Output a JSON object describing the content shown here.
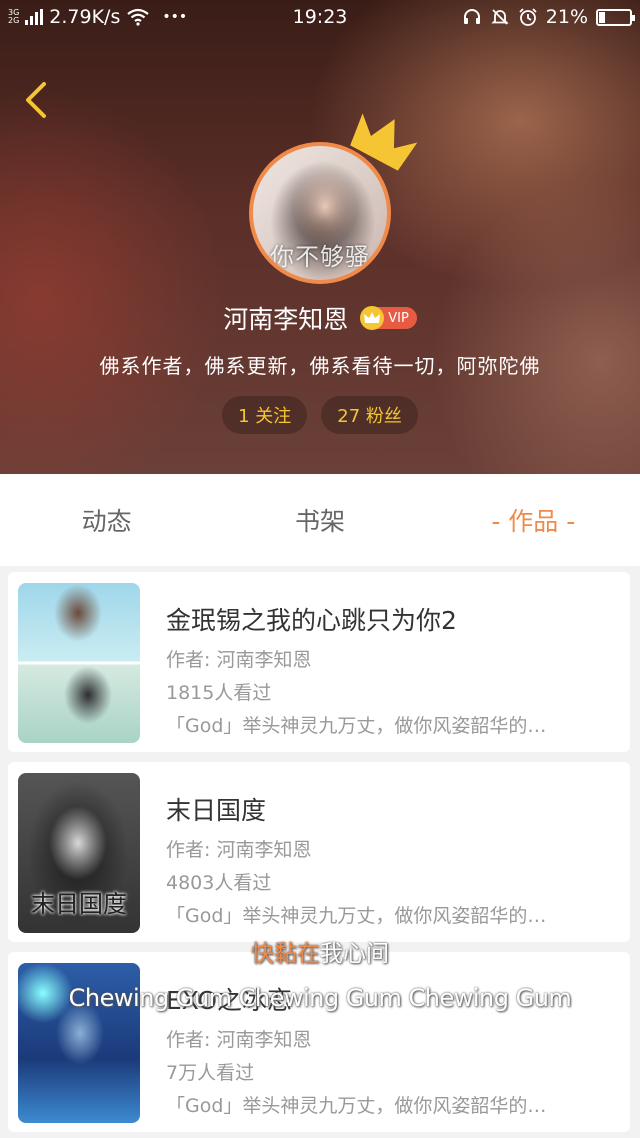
{
  "status_bar": {
    "network_type_top": "3G",
    "network_type_bottom": "2G",
    "speed": "2.79K/s",
    "more": "•••",
    "time": "19:23",
    "battery": "21%",
    "battery_level": 0.21,
    "icons": [
      "signal-icon",
      "wifi-icon",
      "headset-icon",
      "mute-bell-icon",
      "alarm-icon",
      "battery-icon"
    ]
  },
  "profile": {
    "avatar_caption": "你不够骚",
    "username": "河南李知恩",
    "vip_label": "VIP",
    "bio": "佛系作者，佛系更新，佛系看待一切，阿弥陀佛",
    "following": "1 关注",
    "followers": "27 粉丝"
  },
  "tabs": [
    {
      "label": "动态",
      "active": false
    },
    {
      "label": "书架",
      "active": false
    },
    {
      "label": "- 作品 -",
      "active": true
    }
  ],
  "works": [
    {
      "title": "金珉锡之我的心跳只为你2",
      "author": "作者: 河南李知恩",
      "views": "1815人看过",
      "excerpt": "「God」举头神灵九万丈，做你风姿韶华的…",
      "cover_caption": ""
    },
    {
      "title": "末日国度",
      "author": "作者: 河南李知恩",
      "views": "4803人看过",
      "excerpt": "「God」举头神灵九万丈，做你风姿韶华的…",
      "cover_caption": "末日国度"
    },
    {
      "title": "EXO之冰恋",
      "author": "作者: 河南李知恩",
      "views": "7万人看过",
      "excerpt": "「God」举头神灵九万丈，做你风姿韶华的…",
      "cover_caption": ""
    }
  ],
  "overlay_lyrics": {
    "line1_highlight": "快黏在",
    "line1_rest": "我心间",
    "line2": "Chewing Gum Chewing Gum Chewing Gum"
  },
  "colors": {
    "accent": "#f08a4b",
    "gold": "#f5c533",
    "vip_red": "#e85b43"
  }
}
